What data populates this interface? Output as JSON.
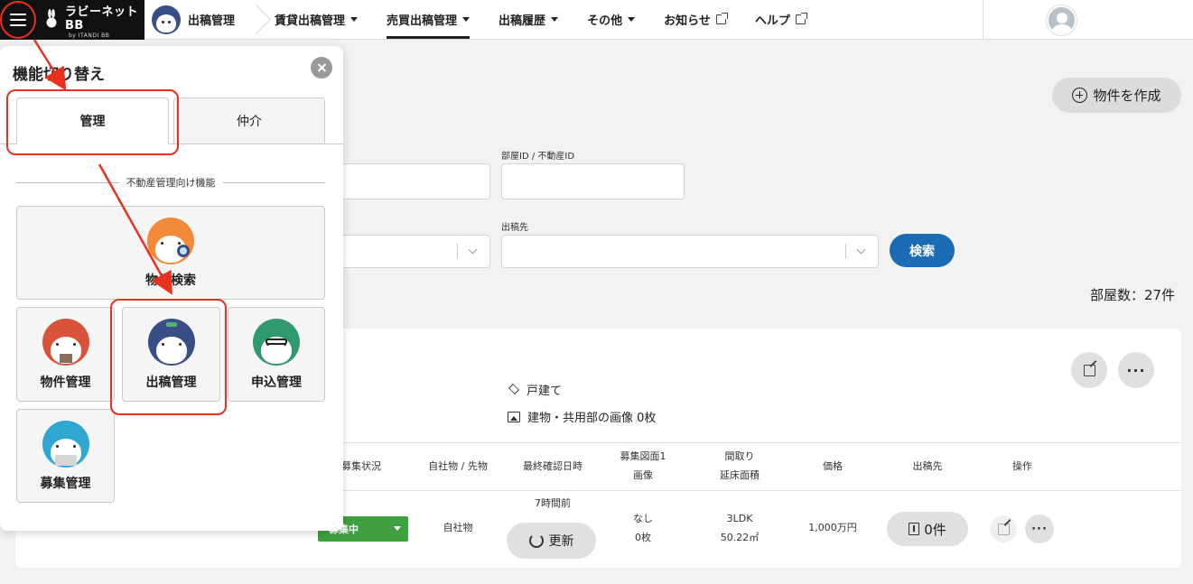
{
  "header": {
    "logo_text": "ラビーネットBB",
    "logo_sub": "by ITANDI BB",
    "app_name": "出稿管理",
    "nav": [
      {
        "label": "賃貸出稿管理"
      },
      {
        "label": "売買出稿管理"
      },
      {
        "label": "出稿履歴"
      },
      {
        "label": "その他"
      },
      {
        "label": "お知らせ"
      },
      {
        "label": "ヘルプ"
      }
    ]
  },
  "main": {
    "create_button": "物件を作成",
    "room_id_label": "部屋ID / 不動産ID",
    "destination_label": "出稿先",
    "search_button": "検索",
    "room_count": "部屋数：27件",
    "card": {
      "property_type": "戸建て",
      "image_info": "建物・共用部の画像 0枚",
      "columns": [
        "募集状況",
        "自社物 / 先物",
        "最終確認日時",
        "募集図面1",
        "画像",
        "間取り",
        "延床面積",
        "価格",
        "出稿先",
        "操作"
      ],
      "row": {
        "status": "募集中",
        "ownership": "自社物",
        "last_checked": "7時間前",
        "update_button": "更新",
        "drawing": "なし",
        "images": "0枚",
        "layout": "3LDK",
        "floor_area": "50.22㎡",
        "price": "1,000万円",
        "destination_count": "0件"
      }
    }
  },
  "panel": {
    "title": "機能切り替え",
    "tabs": [
      "管理",
      "仲介"
    ],
    "section_title": "不動産管理向け機能",
    "tiles": [
      {
        "label": "物件検索",
        "color": "#f28a3a"
      },
      {
        "label": "物件管理",
        "color": "#d9533a"
      },
      {
        "label": "出稿管理",
        "color": "#3a4e86"
      },
      {
        "label": "申込管理",
        "color": "#2f9a6e"
      },
      {
        "label": "募集管理",
        "color": "#2fa7d1"
      }
    ]
  },
  "colors": {
    "accent": "#1c6bb5",
    "status_green": "#3ea03e",
    "annotation_red": "#e8321f"
  }
}
